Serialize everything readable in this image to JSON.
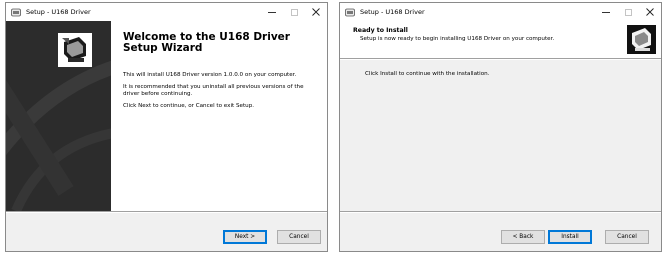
{
  "window1": {
    "title": "Setup - U168 Driver",
    "welcome_title": "Welcome to the U168 Driver Setup Wizard",
    "paragraph1": "This will install U168 Driver version 1.0.0.0 on your computer.",
    "paragraph2": "It is recommended that you uninstall all previous versions of the driver before continuing.",
    "paragraph3": "Click Next to continue, or Cancel to exit Setup.",
    "next_label": "Next >",
    "cancel_label": "Cancel"
  },
  "window2": {
    "title": "Setup - U168 Driver",
    "header_title": "Ready to Install",
    "header_subtitle": "Setup is now ready to begin installing U168 Driver on your computer.",
    "body_text": "Click Install to continue with the installation.",
    "back_label": "< Back",
    "install_label": "Install",
    "cancel_label": "Cancel"
  },
  "colors": {
    "sidebar": "#2c2c2c",
    "default_button_border": "#0078d7"
  }
}
